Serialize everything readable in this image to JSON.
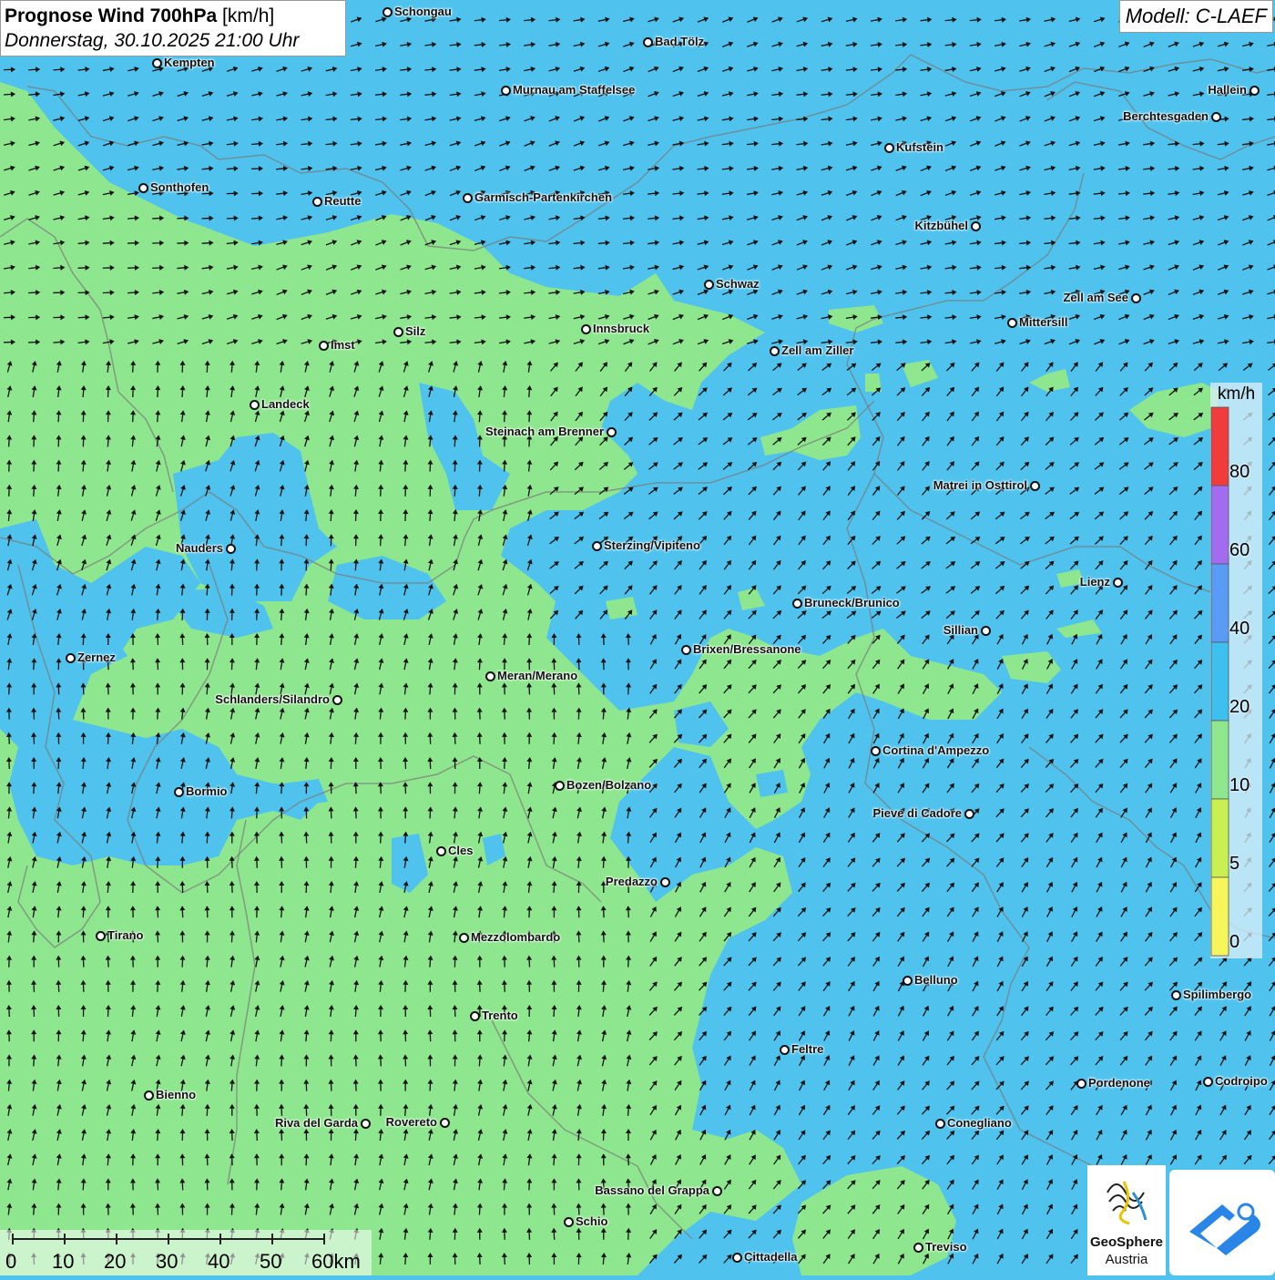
{
  "title": {
    "main": "Prognose Wind 700hPa",
    "unit": "[km/h]",
    "datetime": "Donnerstag, 30.10.2025 21:00 Uhr"
  },
  "model": "Modell: C-LAEF",
  "legend": {
    "unit": "km/h",
    "labels": [
      "80",
      "60",
      "40",
      "20",
      "10",
      "5",
      "0"
    ],
    "colors": [
      "#f03c3c",
      "#a36cf0",
      "#5a9cf5",
      "#3cc0f0",
      "#8ee68e",
      "#c8f050",
      "#f6f65a"
    ],
    "level_colors": {
      "low_wind": "#8ee68e",
      "mid_wind": "#4fc3ee"
    }
  },
  "scale_bar": {
    "labels": [
      "0",
      "10",
      "20",
      "30",
      "40",
      "50",
      "60km"
    ]
  },
  "logo": {
    "name_line1": "GeoSphere",
    "name_line2": "Austria"
  },
  "cities": [
    {
      "name": "Schongau",
      "align": "right"
    },
    {
      "name": "Bad Tölz",
      "align": "right"
    },
    {
      "name": "Kempten",
      "align": "right"
    },
    {
      "name": "Murnau am Staffelsee",
      "align": "right"
    },
    {
      "name": "Hallein",
      "align": "left"
    },
    {
      "name": "Berchtesgaden",
      "align": "left"
    },
    {
      "name": "Kufstein",
      "align": "right"
    },
    {
      "name": "Sonthofen",
      "align": "right"
    },
    {
      "name": "Reutte",
      "align": "right"
    },
    {
      "name": "Garmisch-Partenkirchen",
      "align": "right"
    },
    {
      "name": "Kitzbühel",
      "align": "left"
    },
    {
      "name": "Schwaz",
      "align": "right"
    },
    {
      "name": "Zell am See",
      "align": "left"
    },
    {
      "name": "Mittersill",
      "align": "right"
    },
    {
      "name": "Innsbruck",
      "align": "right"
    },
    {
      "name": "Silz",
      "align": "right"
    },
    {
      "name": "Imst",
      "align": "right"
    },
    {
      "name": "Zell am Ziller",
      "align": "right"
    },
    {
      "name": "Landeck",
      "align": "right"
    },
    {
      "name": "Steinach am Brenner",
      "align": "left"
    },
    {
      "name": "Matrei in Osttirol",
      "align": "left"
    },
    {
      "name": "Nauders",
      "align": "left"
    },
    {
      "name": "Sterzing/Vipiteno",
      "align": "right"
    },
    {
      "name": "Lienz",
      "align": "left"
    },
    {
      "name": "Bruneck/Brunico",
      "align": "right"
    },
    {
      "name": "Sillian",
      "align": "left"
    },
    {
      "name": "Brixen/Bressanone",
      "align": "right"
    },
    {
      "name": "Zernez",
      "align": "right"
    },
    {
      "name": "Meran/Merano",
      "align": "right"
    },
    {
      "name": "Schlanders/Silandro",
      "align": "left"
    },
    {
      "name": "Cortina d'Ampezzo",
      "align": "right"
    },
    {
      "name": "Bozen/Bolzano",
      "align": "right"
    },
    {
      "name": "Bormio",
      "align": "right"
    },
    {
      "name": "Pieve di Cadore",
      "align": "left"
    },
    {
      "name": "Cles",
      "align": "right"
    },
    {
      "name": "Predazzo",
      "align": "left"
    },
    {
      "name": "Tirano",
      "align": "right"
    },
    {
      "name": "Mezzolombardo",
      "align": "right"
    },
    {
      "name": "Belluno",
      "align": "right"
    },
    {
      "name": "Spilimbergo",
      "align": "right"
    },
    {
      "name": "Trento",
      "align": "right"
    },
    {
      "name": "Feltre",
      "align": "right"
    },
    {
      "name": "Bienno",
      "align": "right"
    },
    {
      "name": "Pordenone",
      "align": "right"
    },
    {
      "name": "Codroipo",
      "align": "right"
    },
    {
      "name": "Riva del Garda",
      "align": "left"
    },
    {
      "name": "Rovereto",
      "align": "left"
    },
    {
      "name": "Conegliano",
      "align": "right"
    },
    {
      "name": "Bassano del Grappa",
      "align": "left"
    },
    {
      "name": "Schio",
      "align": "right"
    },
    {
      "name": "Treviso",
      "align": "right"
    },
    {
      "name": "Cittadella",
      "align": "right"
    }
  ]
}
